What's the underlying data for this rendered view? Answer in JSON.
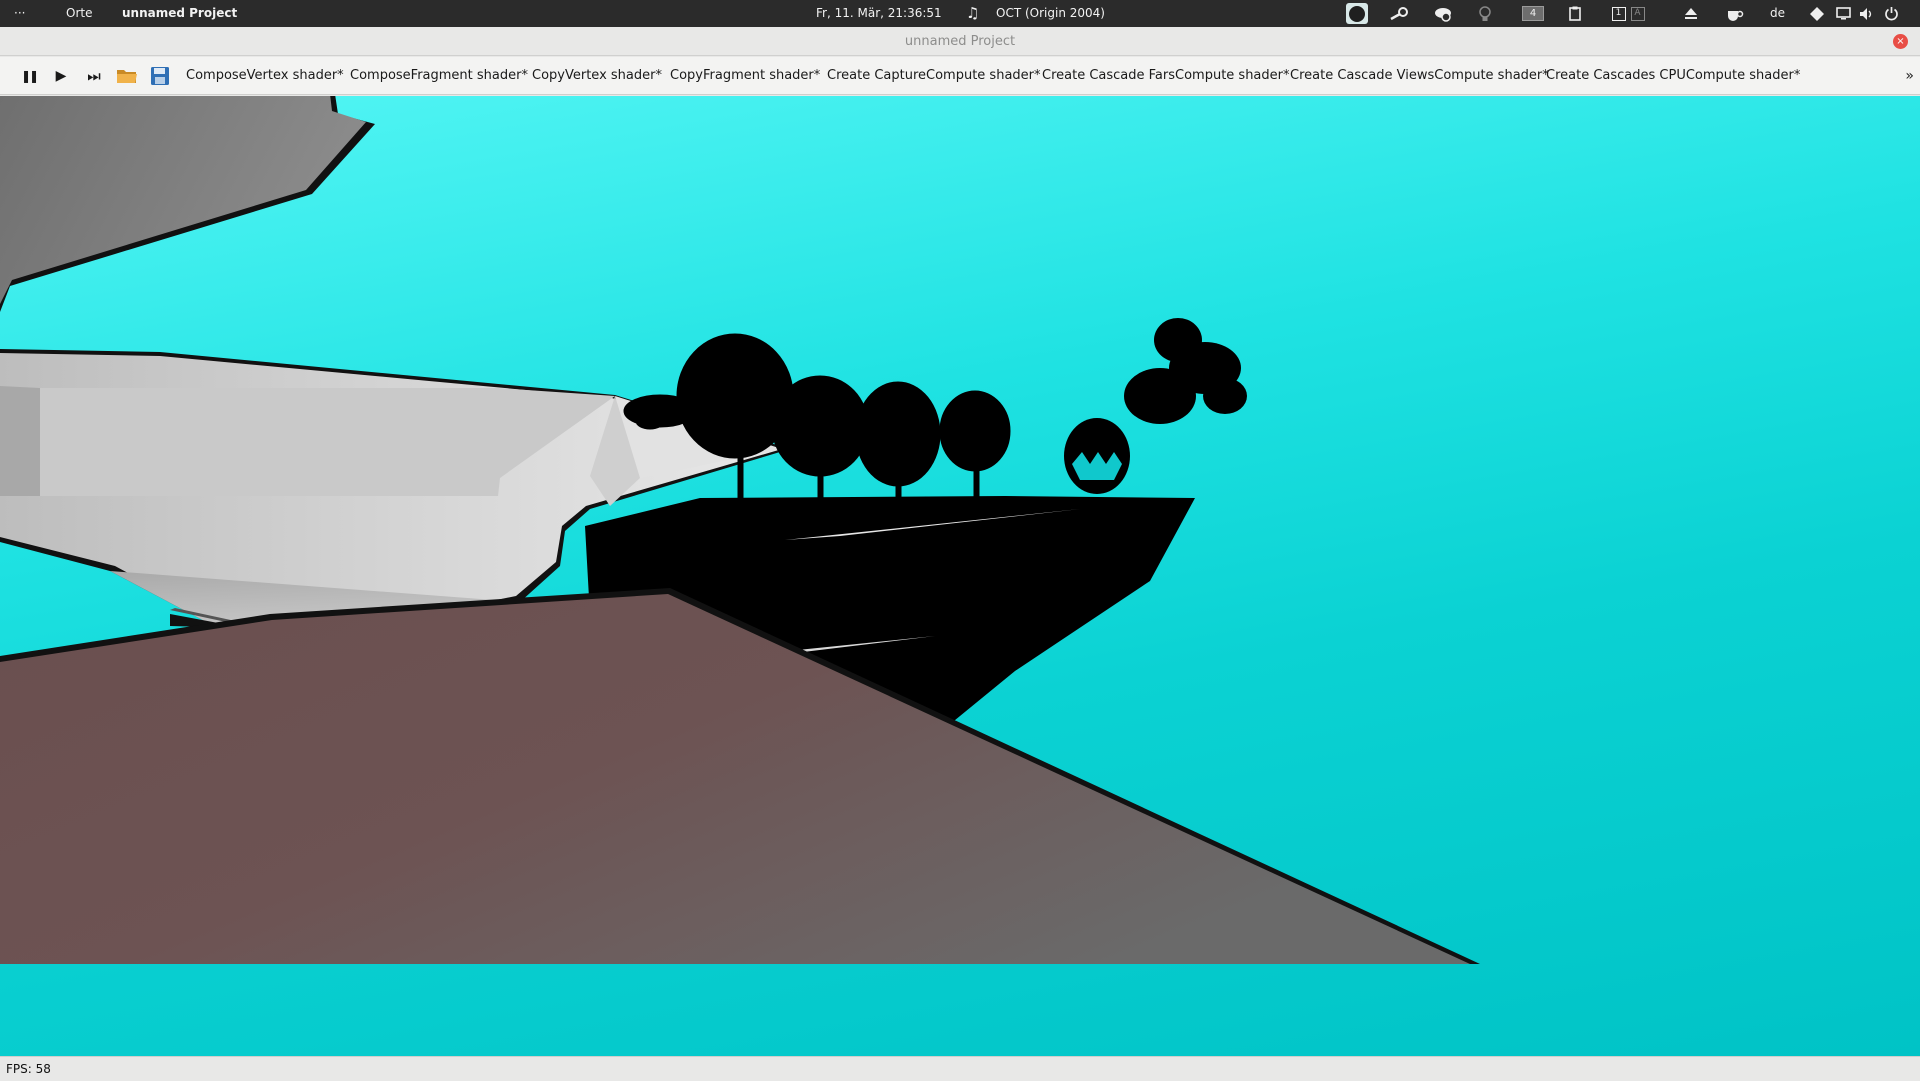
{
  "topbar": {
    "activities": "···",
    "places": "Orte",
    "app_name": "unnamed Project",
    "datetime": "Fr, 11. Mär, 21:36:51",
    "music_glyph": "♫",
    "now_playing": "OCT (Origin 2004)",
    "workspace_number": "4",
    "layout_indicator_1": "1",
    "layout_indicator_2": "A",
    "keyboard_layout": "de",
    "icons": {
      "spotify": "spotify-icon",
      "steam": "steam-icon",
      "cloud": "cloud-check-icon",
      "bulb": "lightbulb-icon",
      "clipboard": "clipboard-icon",
      "eject": "eject-icon",
      "cup": "coffee-cup-icon",
      "network": "network-icon",
      "display": "display-icon",
      "volume": "volume-icon",
      "power": "power-icon"
    }
  },
  "titlebar": {
    "title": "unnamed Project",
    "close_glyph": "×"
  },
  "toolbar": {
    "buttons": {
      "pause_glyph": "❚❚",
      "play_glyph": "▶",
      "skip_glyph": "⏭"
    },
    "tabs": [
      "ComposeVertex shader*",
      "ComposeFragment shader*",
      "CopyVertex shader*",
      "CopyFragment shader*",
      "Create CaptureCompute shader*",
      "Create Cascade FarsCompute shader*",
      "Create Cascade ViewsCompute shader*",
      "Create Cascades CPUCompute shader*"
    ],
    "more_glyph": "»"
  },
  "viewport": {
    "sky_top": "#55f6f5",
    "sky_bottom": "#00c3c6"
  },
  "statusbar": {
    "fps": "FPS: 58"
  },
  "colors": {
    "accent_close": "#e84d45",
    "topbar_bg": "#2b2b2b",
    "folder": "#e9a43a",
    "save": "#2f6fb5"
  }
}
